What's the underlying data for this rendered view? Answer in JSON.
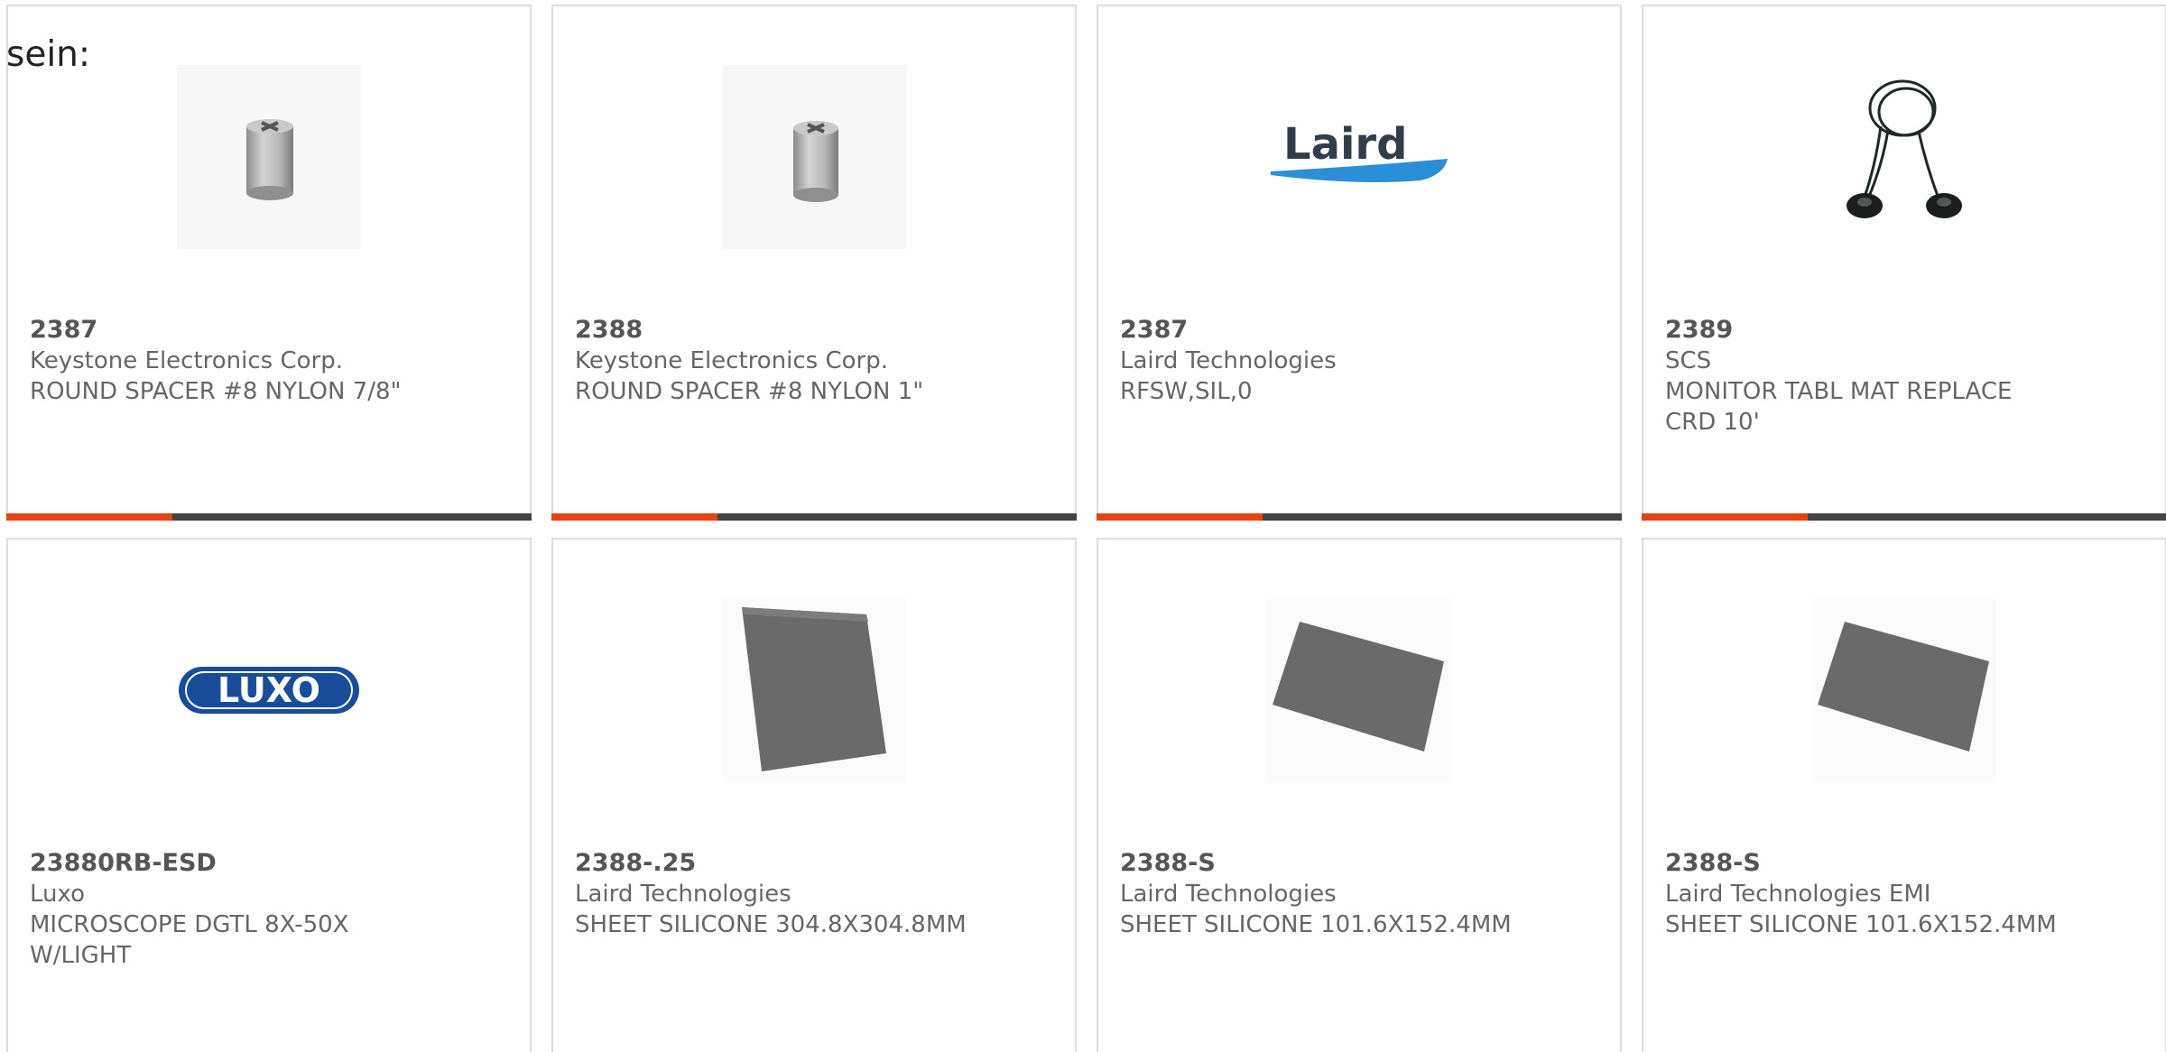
{
  "intro_text": "sein:",
  "theme": {
    "accent_color": "#e64212",
    "bar_color": "#444444",
    "border_color": "#dddddd",
    "text_color": "#666666"
  },
  "products": [
    {
      "part_number": "2387",
      "manufacturer": "Keystone Electronics Corp.",
      "description": "ROUND SPACER #8 NYLON 7/8\"",
      "image": "round-spacer-image"
    },
    {
      "part_number": "2388",
      "manufacturer": "Keystone Electronics Corp.",
      "description": "ROUND SPACER #8 NYLON 1\"",
      "image": "round-spacer-image"
    },
    {
      "part_number": "2387",
      "manufacturer": "Laird Technologies",
      "description": "RFSW,SIL,0",
      "image": "laird-logo",
      "logo_text": "Laird"
    },
    {
      "part_number": "2389",
      "manufacturer": "SCS",
      "description": "MONITOR TABL MAT REPLACE CRD 10'",
      "image": "ground-cord-image"
    },
    {
      "part_number": "23880RB-ESD",
      "manufacturer": "Luxo",
      "description": "MICROSCOPE DGTL 8X-50X W/LIGHT",
      "image": "luxo-logo",
      "logo_text": "LUXO"
    },
    {
      "part_number": "2388-.25",
      "manufacturer": "Laird Technologies",
      "description": "SHEET SILICONE 304.8X304.8MM",
      "image": "silicone-sheet-image"
    },
    {
      "part_number": "2388-S",
      "manufacturer": "Laird Technologies",
      "description": "SHEET SILICONE 101.6X152.4MM",
      "image": "silicone-sheet-image"
    },
    {
      "part_number": "2388-S",
      "manufacturer": "Laird Technologies EMI",
      "description": "SHEET SILICONE 101.6X152.4MM",
      "image": "silicone-sheet-image"
    }
  ]
}
